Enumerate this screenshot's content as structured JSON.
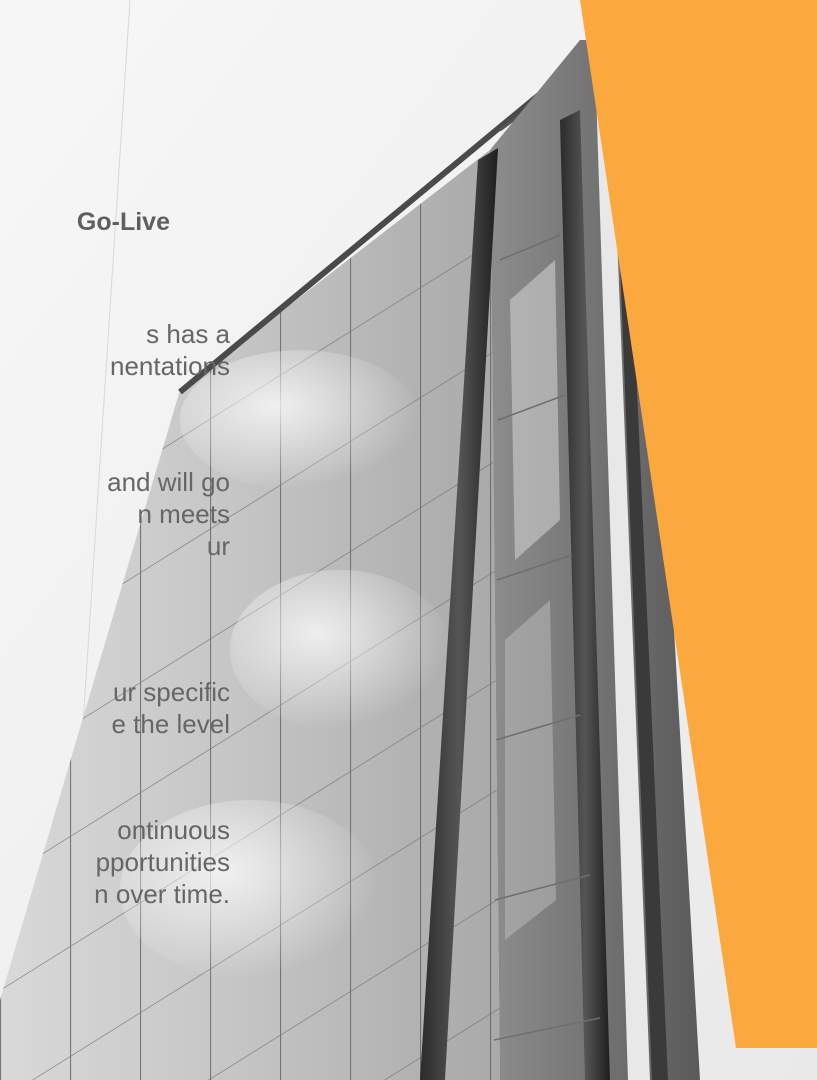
{
  "slide": {
    "heading": "Go-Live",
    "paragraphs": [
      {
        "lines": [
          "s has a",
          "nentations"
        ]
      },
      {
        "lines": [
          "and will go",
          "n meets",
          "ur"
        ]
      },
      {
        "lines": [
          "ur specific",
          "e the level"
        ]
      },
      {
        "lines": [
          "ontinuous",
          "pportunities",
          "n over time."
        ]
      }
    ]
  },
  "colors": {
    "accent": "#FBA83E",
    "text": "#616161",
    "background": "#F3F3F3"
  }
}
